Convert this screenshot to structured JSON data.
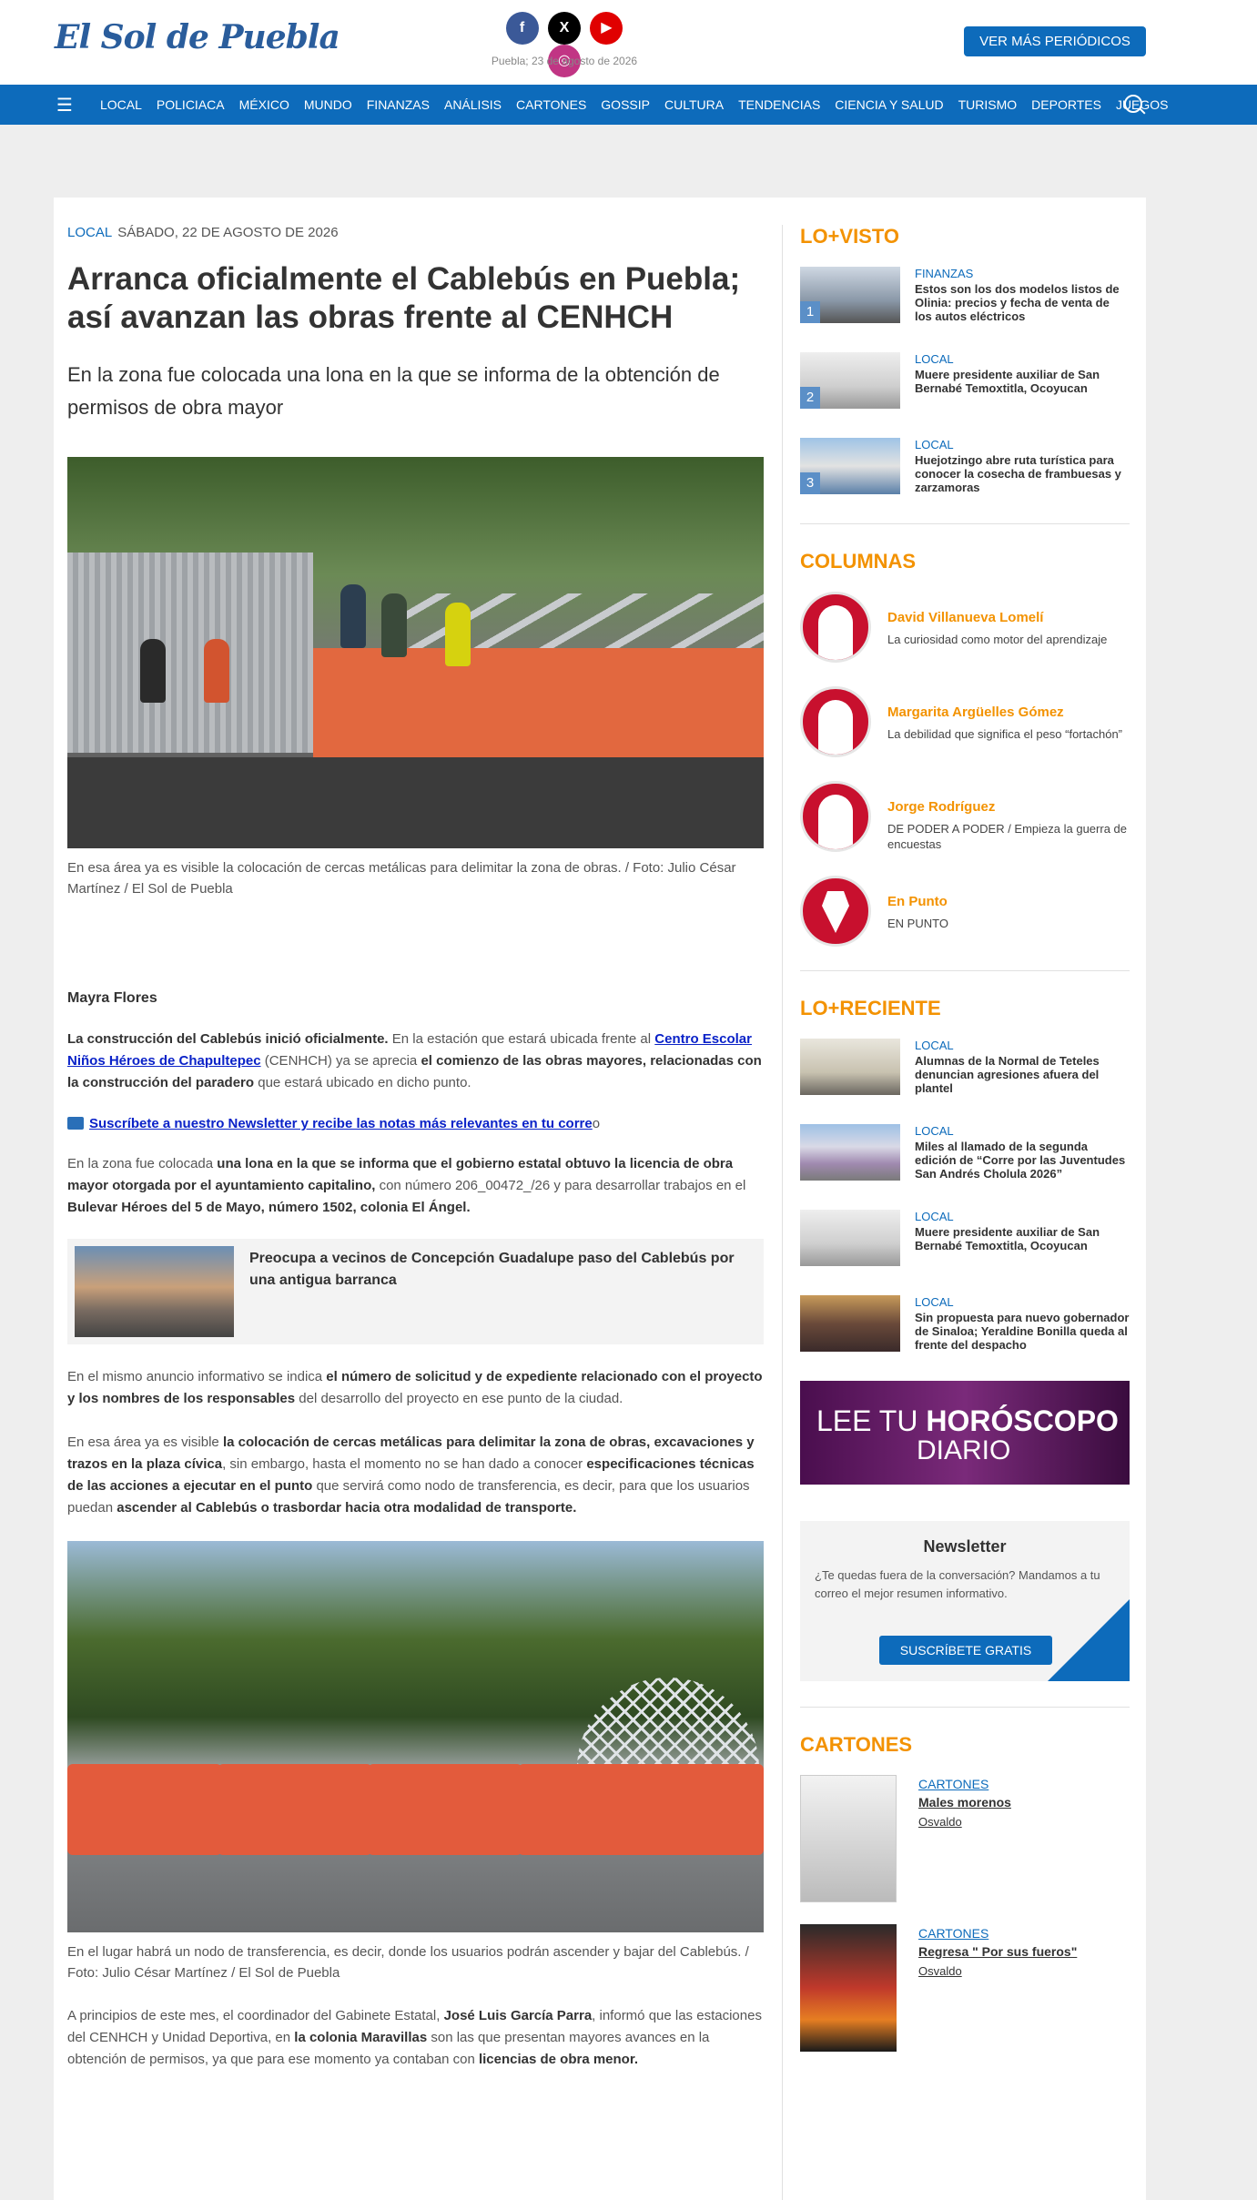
{
  "header": {
    "logo": "El Sol de Puebla",
    "date": "Puebla; 23 de agosto de 2026",
    "more_button": "VER MÁS PERIÓDICOS",
    "socials": [
      "f",
      "X",
      "▶",
      "◎"
    ]
  },
  "nav": {
    "items": [
      "LOCAL",
      "POLICIACA",
      "MÉXICO",
      "MUNDO",
      "FINANZAS",
      "ANÁLISIS",
      "CARTONES",
      "GOSSIP",
      "CULTURA",
      "TENDENCIAS",
      "CIENCIA Y SALUD",
      "TURISMO",
      "DEPORTES",
      "JUEGOS"
    ]
  },
  "article": {
    "category": "LOCAL",
    "date": "SÁBADO, 22 DE AGOSTO DE 2026",
    "headline": "Arranca oficialmente el Cablebús en Puebla; así avanzan las obras frente al CENHCH",
    "summary": "En la zona fue colocada una lona en la que se informa de la obtención de permisos de obra mayor",
    "caption1": "En esa área ya es visible la colocación de cercas metálicas para delimitar la zona de obras. / Foto: Julio César Martínez / El Sol de Puebla",
    "author": "Mayra Flores",
    "p1_b1": "La construcción del Cablebús inició oficialmente.",
    "p1_t1": " En la estación que estará ubicada frente al ",
    "p1_link": "Centro Escolar Niños Héroes de Chapultepec",
    "p1_t2": " (CENHCH) ya se aprecia ",
    "p1_b2": "el comienzo de las obras mayores, relacionadas con la construcción del paradero",
    "p1_t3": " que estará ubicado en dicho punto.",
    "newsletter_link": "Suscríbete a nuestro Newsletter y recibe las notas más relevantes en tu corre",
    "newsletter_tail": "o",
    "p2_t1": "En la zona fue colocada ",
    "p2_b1": "una lona en la que se informa que el gobierno estatal obtuvo la licencia de obra mayor otorgada por el ayuntamiento capitalino,",
    "p2_t2": " con número 206_00472_/26 y para desarrollar trabajos en el ",
    "p2_b2": "Bulevar Héroes del 5 de Mayo, número 1502, colonia El Ángel.",
    "related_title": "Preocupa a vecinos de Concepción Guadalupe paso del Cablebús por una antigua barranca",
    "p3_t1": "En el mismo anuncio informativo se indica ",
    "p3_b1": "el número de solicitud y de expediente relacionado con el proyecto y los nombres de los responsables",
    "p3_t2": " del desarrollo del proyecto en ese punto de la ciudad.",
    "p4_t1": "En esa área ya es visible ",
    "p4_b1": "la colocación de cercas metálicas para delimitar la zona de obras, excavaciones y trazos en la plaza cívica",
    "p4_t2": ", sin embargo, hasta el momento no se han dado a conocer ",
    "p4_b2": "especificaciones técnicas de las acciones a ejecutar en el punto",
    "p4_t3": " que servirá como nodo de transferencia, es decir, para que los usuarios puedan ",
    "p4_b3": "ascender al Cablebús o trasbordar hacia otra modalidad de transporte.",
    "caption2": "En el lugar habrá un nodo de transferencia, es decir, donde los usuarios podrán ascender y bajar del Cablebús. / Foto: Julio César Martínez / El Sol de Puebla",
    "p5_t1": "A principios de este mes, el coordinador del Gabinete Estatal, ",
    "p5_b1": "José Luis García Parra",
    "p5_t2": ", informó que las estaciones del CENHCH y Unidad Deportiva, en ",
    "p5_b2": "la colonia Maravillas",
    "p5_t3": " son las que presentan mayores avances en la obtención de permisos, ya que para ese momento ya contaban con ",
    "p5_b3": "licencias de obra menor."
  },
  "sidebar": {
    "lovisto_title": "LO+VISTO",
    "lovisto": [
      {
        "num": "1",
        "cat": "FINANZAS",
        "title": "Estos son los dos modelos listos de Olinia: precios y fecha de venta de los autos eléctricos"
      },
      {
        "num": "2",
        "cat": "LOCAL",
        "title": "Muere presidente auxiliar de San Bernabé Temoxtitla, Ocoyucan"
      },
      {
        "num": "3",
        "cat": "LOCAL",
        "title": "Huejotzingo abre ruta turística para conocer la cosecha de frambuesas y zarzamoras"
      }
    ],
    "columnas_title": "COLUMNAS",
    "columnas": [
      {
        "name": "David Villanueva Lomelí",
        "desc": "La curiosidad como motor del aprendizaje"
      },
      {
        "name": "Margarita Argüelles Gómez",
        "desc": "La debilidad que significa el peso “fortachón”"
      },
      {
        "name": "Jorge Rodríguez",
        "desc": "DE PODER A PODER / Empieza la guerra de encuestas"
      },
      {
        "name": "En Punto",
        "desc": "EN PUNTO"
      }
    ],
    "loreciente_title": "LO+RECIENTE",
    "loreciente": [
      {
        "cat": "LOCAL",
        "title": "Alumnas de la Normal de Teteles denuncian agresiones afuera del plantel"
      },
      {
        "cat": "LOCAL",
        "title": "Miles al llamado de la segunda edición de “Corre por las Juventudes San Andrés Cholula 2026”"
      },
      {
        "cat": "LOCAL",
        "title": "Muere presidente auxiliar de San Bernabé Temoxtitla, Ocoyucan"
      },
      {
        "cat": "LOCAL",
        "title": "Sin propuesta para nuevo gobernador de Sinaloa; Yeraldine Bonilla queda al frente del despacho"
      }
    ],
    "horoscopo_l1a": "LEE TU ",
    "horoscopo_l1b": "HORÓSCOPO",
    "horoscopo_l2": "DIARIO",
    "newsletter_title": "Newsletter",
    "newsletter_text": "¿Te quedas fuera de la conversación? Mandamos a tu correo el mejor resumen informativo.",
    "newsletter_button": "SUSCRÍBETE GRATIS",
    "cartones_title": "CARTONES",
    "cartones": [
      {
        "cat": "CARTONES",
        "title": "Males morenos",
        "author": "Osvaldo"
      },
      {
        "cat": "CARTONES",
        "title": "Regresa \" Por sus fueros\"",
        "author": "Osvaldo"
      }
    ]
  },
  "colors": {
    "brand_blue": "#0d6bbb",
    "accent_orange": "#f39200",
    "column_red": "#c8102e"
  }
}
